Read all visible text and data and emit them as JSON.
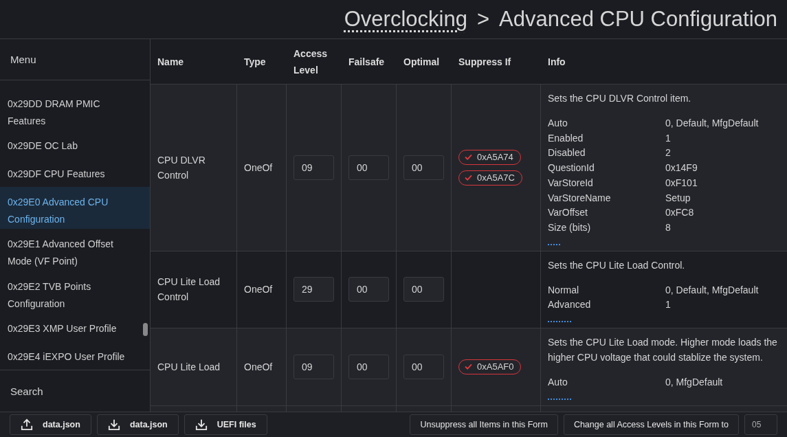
{
  "breadcrumb": {
    "parent": "Overclocking",
    "separator": ">",
    "current": "Advanced CPU Configuration"
  },
  "sidebar": {
    "title": "Menu",
    "items": [
      {
        "label": "0x29DD DRAM PMIC Features",
        "selected": false
      },
      {
        "label": "0x29DE OC Lab",
        "selected": false
      },
      {
        "label": "0x29DF CPU Features",
        "selected": false
      },
      {
        "label": "0x29E0 Advanced CPU Configuration",
        "selected": true
      },
      {
        "label": "0x29E1 Advanced Offset Mode (VF Point)",
        "selected": false
      },
      {
        "label": "0x29E2 TVB Points Configuration",
        "selected": false
      },
      {
        "label": "0x29E3 XMP User Profile",
        "selected": false
      },
      {
        "label": "0x29E4 iEXPO User Profile",
        "selected": false
      }
    ],
    "search_label": "Search"
  },
  "table": {
    "columns": [
      "Name",
      "Type",
      "Access Level",
      "Failsafe",
      "Optimal",
      "Suppress If",
      "Info"
    ],
    "rows": [
      {
        "name": "CPU DLVR Control",
        "type": "OneOf",
        "access_level": "09",
        "failsafe": "00",
        "optimal": "00",
        "suppress_if": [
          "0xA5A74",
          "0xA5A7C"
        ],
        "info": {
          "description": "Sets the CPU DLVR Control item.",
          "expanded": true,
          "fields": [
            [
              "Auto",
              "0, Default, MfgDefault"
            ],
            [
              "Enabled",
              "1"
            ],
            [
              "Disabled",
              "2"
            ],
            [
              "QuestionId",
              "0x14F9"
            ],
            [
              "VarStoreId",
              "0xF101"
            ],
            [
              "VarStoreName",
              "Setup"
            ],
            [
              "VarOffset",
              "0xFC8"
            ],
            [
              "Size (bits)",
              "8"
            ]
          ]
        }
      },
      {
        "name": "CPU Lite Load Control",
        "type": "OneOf",
        "access_level": "29",
        "failsafe": "00",
        "optimal": "00",
        "suppress_if": [],
        "info": {
          "description": "Sets the CPU Lite Load Control.",
          "expanded": false,
          "fields": [
            [
              "Normal",
              "0, Default, MfgDefault"
            ],
            [
              "Advanced",
              "1"
            ]
          ]
        }
      },
      {
        "name": "CPU Lite Load",
        "type": "OneOf",
        "access_level": "09",
        "failsafe": "00",
        "optimal": "00",
        "suppress_if": [
          "0xA5AF0"
        ],
        "info": {
          "description": "Sets the CPU Lite Load mode. Higher mode loads the higher CPU voltage that could stablize the system.",
          "expanded": false,
          "fields": [
            [
              "Auto",
              "0, MfgDefault"
            ]
          ]
        }
      }
    ]
  },
  "footer": {
    "buttons": [
      {
        "kind": "upload",
        "label": "data.json"
      },
      {
        "kind": "download",
        "label": "data.json"
      },
      {
        "kind": "download",
        "label": "UEFI files"
      }
    ],
    "unsuppress_button": "Unsuppress all Items in this Form",
    "change_button": "Change all Access Levels in this Form to",
    "access_level_value": "05"
  }
}
